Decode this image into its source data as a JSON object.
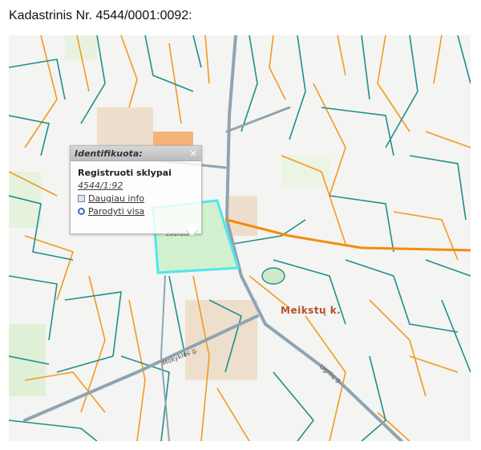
{
  "heading": "Kadastrinis Nr. 4544/0001:0092:",
  "popup": {
    "title": "Identifikuota:",
    "close_symbol": "×",
    "section": "Registruoti sklypai",
    "parcel_id": "4544/1:92",
    "more_info": "Daugiau info",
    "show_all": "Parodyti visa",
    "icons": [
      "document-icon",
      "search-icon",
      "close-icon"
    ]
  },
  "map": {
    "village_label": "Meikstų k.",
    "street_labels": [
      "Meiks",
      "g.",
      "žvardis",
      "Mokyklos g.",
      "Ugnių g."
    ],
    "colors": {
      "background": "#f4f4f2",
      "parcel_boundary": "#1f8f8c",
      "land_boundary": "#f29a1f",
      "road": "#9fb0bb",
      "main_road": "#f28c0e",
      "selected_fill": "#c9efc8",
      "selected_border": "#4fe7ef",
      "buildings": "#e9c9a4"
    }
  }
}
